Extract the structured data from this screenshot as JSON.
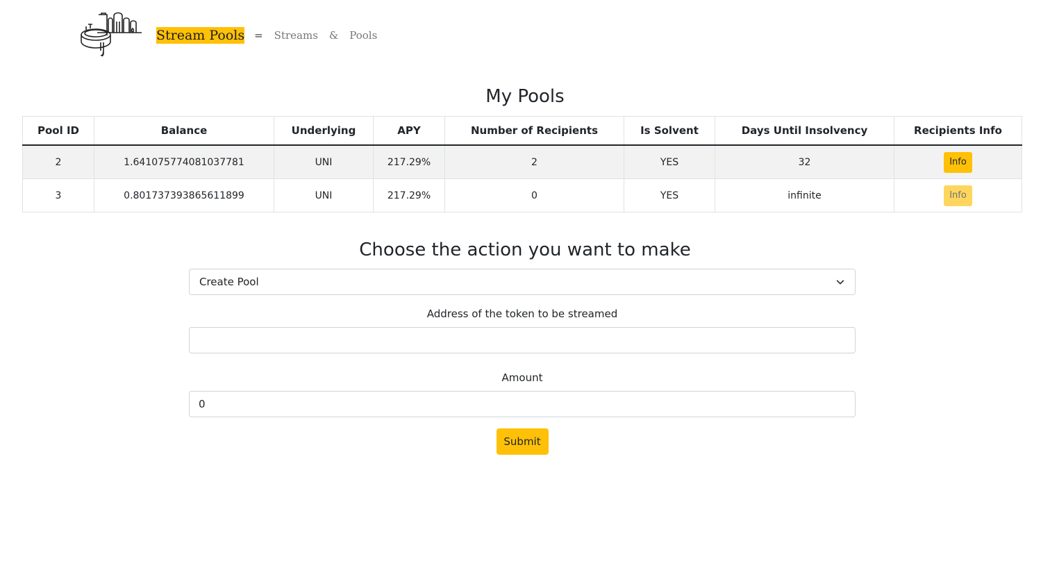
{
  "header": {
    "brand": "Stream Pools",
    "equals": "=",
    "nav_streams": "Streams",
    "ampersand": "&",
    "nav_pools": "Pools",
    "logo_icon": "pool-faucet-logo-icon"
  },
  "pools_section": {
    "title": "My Pools",
    "columns": [
      "Pool ID",
      "Balance",
      "Underlying",
      "APY",
      "Number of Recipients",
      "Is Solvent",
      "Days Until Insolvency",
      "Recipients Info"
    ],
    "rows": [
      {
        "pool_id": "2",
        "balance": "1.641075774081037781",
        "underlying": "UNI",
        "apy": "217.29%",
        "recipients": "2",
        "solvent": "YES",
        "days": "32",
        "info_label": "Info"
      },
      {
        "pool_id": "3",
        "balance": "0.801737393865611899",
        "underlying": "UNI",
        "apy": "217.29%",
        "recipients": "0",
        "solvent": "YES",
        "days": "infinite",
        "info_label": "Info"
      }
    ]
  },
  "action_section": {
    "title": "Choose the action you want to make",
    "selected_action": "Create Pool",
    "token_label": "Address of the token to be streamed",
    "token_value": "",
    "amount_label": "Amount",
    "amount_value": "0",
    "submit_label": "Submit"
  },
  "colors": {
    "accent": "#ffc107",
    "border": "#dee2e6",
    "stripe": "#f2f2f2"
  }
}
